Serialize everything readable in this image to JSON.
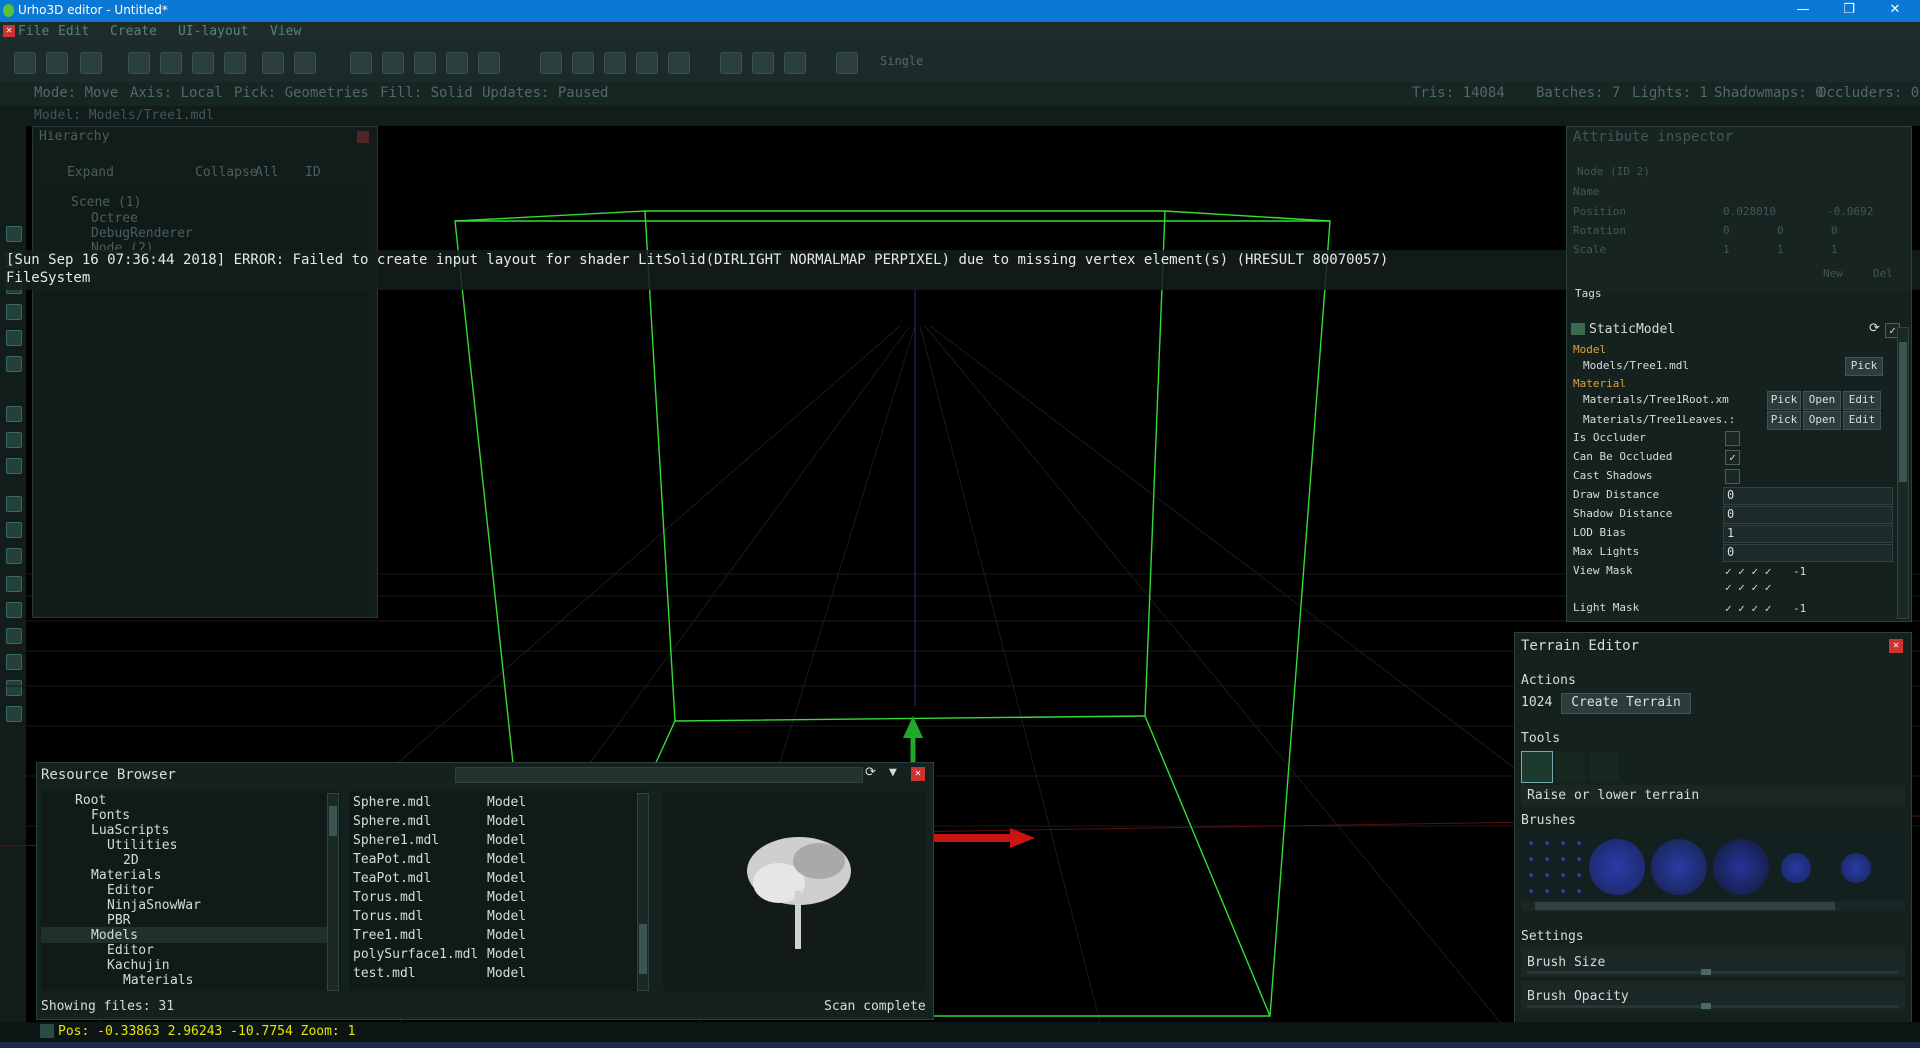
{
  "window": {
    "title": "Urho3D editor - Untitled*",
    "minimize": "—",
    "maximize": "❐",
    "close": "✕"
  },
  "menu": {
    "items": [
      "File",
      "Edit",
      "Create",
      "UI-layout",
      "View"
    ]
  },
  "toolbar": {
    "pick_mode": "Single"
  },
  "status": {
    "mode": "Mode: Move",
    "axis": "Axis: Local",
    "pick": "Pick: Geometries",
    "fill": "Fill: Solid",
    "updates": "Updates: Paused",
    "tris": "Tris: 14084",
    "batches": "Batches: 7",
    "lights": "Lights: 1",
    "shadowmaps": "Shadowmaps: 0",
    "occluders": "Occluders: 0"
  },
  "model_line": "Model: Models/Tree1.mdl",
  "hierarchy": {
    "title": "Hierarchy",
    "expand": "Expand",
    "collapse": "Collapse",
    "all": "All",
    "id": "ID",
    "items": [
      "Scene (1)",
      "Octree",
      "DebugRenderer",
      "Node (2)"
    ]
  },
  "log": {
    "error": "[Sun Sep 16 07:36:44 2018] ERROR: Failed to create input layout for shader LitSolid(DIRLIGHT NORMALMAP PERPIXEL) due to missing vertex element(s) (HRESULT 80070057)",
    "filesystem": "FileSystem"
  },
  "attribute_inspector": {
    "title": "Attribute inspector",
    "node": "Node (ID 2)",
    "labels": {
      "name": "Name",
      "position": "Position",
      "rotation": "Rotation",
      "scale": "Scale"
    },
    "position": [
      "0.028010",
      "-0.0692"
    ],
    "rotation": [
      "0",
      "0",
      "0"
    ],
    "scale": [
      "1",
      "1",
      "1"
    ],
    "new": "New",
    "del": "Del",
    "tags": "Tags",
    "component": "StaticModel",
    "model_header": "Model",
    "model_value": "Models/Tree1.mdl",
    "material_header": "Material",
    "materials": [
      "Materials/Tree1Root.xm",
      "Materials/Tree1Leaves.:"
    ],
    "pick": "Pick",
    "open": "Open",
    "edit": "Edit",
    "attrs": [
      {
        "label": "Is Occluder",
        "checked": ""
      },
      {
        "label": "Can Be Occluded",
        "checked": "✓"
      },
      {
        "label": "Cast Shadows",
        "checked": ""
      }
    ],
    "values": [
      {
        "label": "Draw Distance",
        "value": "0"
      },
      {
        "label": "Shadow Distance",
        "value": "0"
      },
      {
        "label": "LOD Bias",
        "value": "1"
      },
      {
        "label": "Max Lights",
        "value": "0"
      }
    ],
    "view_mask": "View Mask",
    "light_mask": "Light Mask",
    "mask_value": "-1",
    "checks": "✓ ✓ ✓ ✓"
  },
  "terrain": {
    "title": "Terrain Editor",
    "actions": "Actions",
    "size": "1024",
    "create": "Create Terrain",
    "tools": "Tools",
    "tool_desc": "Raise or lower terrain",
    "brushes": "Brushes",
    "settings": "Settings",
    "brush_size": "Brush Size",
    "brush_opacity": "Brush Opacity",
    "brush_size_frac": 0.48,
    "brush_opacity_frac": 0.48
  },
  "resource_browser": {
    "title": "Resource Browser",
    "tree": [
      "Root",
      "Fonts",
      "LuaScripts",
      "Utilities",
      "2D",
      "Materials",
      "Editor",
      "NinjaSnowWar",
      "PBR",
      "Models",
      "Editor",
      "Kachujin",
      "Materials"
    ],
    "files": [
      {
        "name": "Sphere.mdl",
        "type": "Model"
      },
      {
        "name": "Sphere.mdl",
        "type": "Model"
      },
      {
        "name": "Sphere1.mdl",
        "type": "Model"
      },
      {
        "name": "TeaPot.mdl",
        "type": "Model"
      },
      {
        "name": "TeaPot.mdl",
        "type": "Model"
      },
      {
        "name": "Torus.mdl",
        "type": "Model"
      },
      {
        "name": "Torus.mdl",
        "type": "Model"
      },
      {
        "name": "Tree1.mdl",
        "type": "Model"
      },
      {
        "name": "polySurface1.mdl",
        "type": "Model"
      },
      {
        "name": "test.mdl",
        "type": "Model"
      }
    ],
    "showing": "Showing files: 31",
    "scan": "Scan complete"
  },
  "bottom": {
    "pos": "Pos: -0.33863 2.96243  -10.7754 Zoom: 1"
  },
  "colors": {
    "titlebar": "#0a78d4",
    "panel": "#15211f",
    "bbox": "#33dd33",
    "axis_y": "#1fa82a",
    "axis_x": "#c81414",
    "status_yellow": "#e6e600"
  }
}
